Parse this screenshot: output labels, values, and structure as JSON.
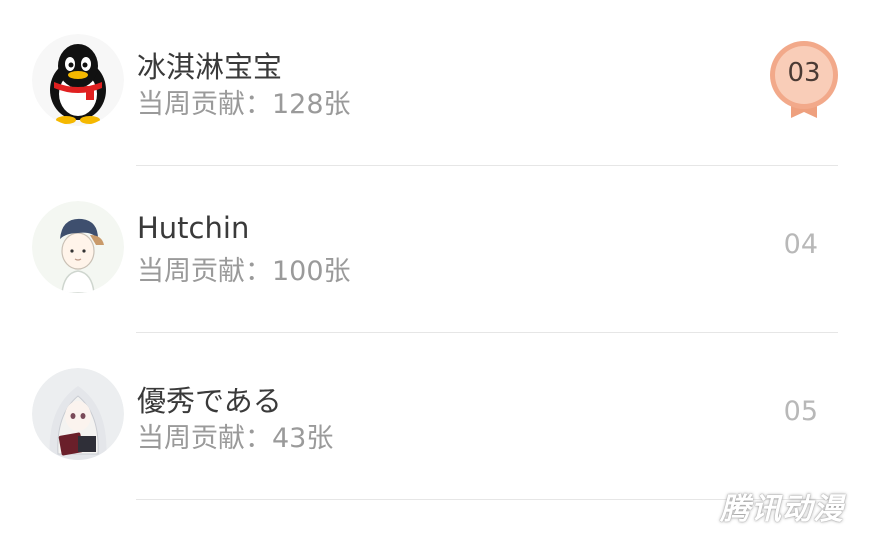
{
  "rows": [
    {
      "name": "冰淇淋宝宝",
      "contribution": "当周贡献：128张",
      "rank": "03",
      "avatar": "qq-penguin-icon"
    },
    {
      "name": "Hutchin",
      "contribution": "当周贡献：100张",
      "rank": "04",
      "avatar": "cartoon-boy-cap"
    },
    {
      "name": "優秀である",
      "contribution": "当周贡献：43张",
      "rank": "05",
      "avatar": "anime-girl-book"
    }
  ],
  "watermark": "腾讯动漫",
  "colors": {
    "medal_bronze": "#f2a98a",
    "medal_inner": "#f9cdb8",
    "rank_gray": "#b8b8b8"
  }
}
